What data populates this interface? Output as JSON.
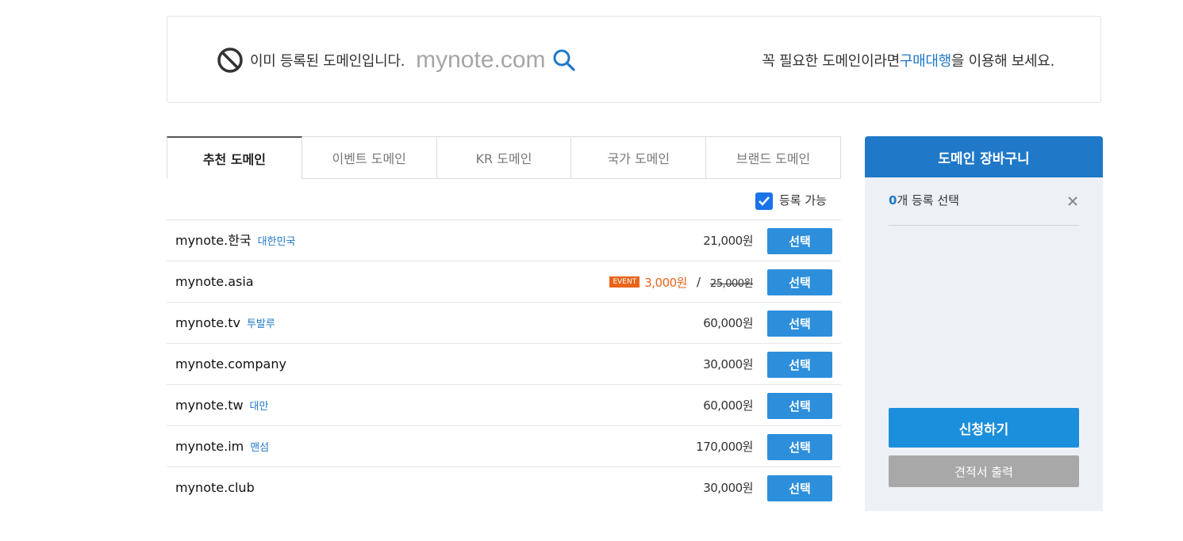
{
  "result": {
    "message": "이미 등록된 도메인입니다.",
    "query": "mynote.com",
    "hint_pre": "꼭 필요한 도메인이라면 ",
    "hint_link": "구매대행",
    "hint_post": "을 이용해 보세요.",
    "status_icon": "ban-icon",
    "search_icon": "search-icon"
  },
  "tabs": [
    {
      "label": "추천 도메인",
      "active": true
    },
    {
      "label": "이벤트 도메인",
      "active": false
    },
    {
      "label": "KR 도메인",
      "active": false
    },
    {
      "label": "국가 도메인",
      "active": false
    },
    {
      "label": "브랜드 도메인",
      "active": false
    }
  ],
  "filter": {
    "label": "등록 가능",
    "checked": true
  },
  "domains": [
    {
      "name": "mynote.한국",
      "country": "대한민국",
      "price": "21,000원",
      "button": "선택"
    },
    {
      "name": "mynote.asia",
      "country": "",
      "badge": "EVENT",
      "event_price": "3,000원",
      "separator": "/",
      "old_price": "25,000원",
      "button": "선택"
    },
    {
      "name": "mynote.tv",
      "country": "투발루",
      "price": "60,000원",
      "button": "선택"
    },
    {
      "name": "mynote.company",
      "country": "",
      "price": "30,000원",
      "button": "선택"
    },
    {
      "name": "mynote.tw",
      "country": "대만",
      "price": "60,000원",
      "button": "선택"
    },
    {
      "name": "mynote.im",
      "country": "맨섬",
      "price": "170,000원",
      "button": "선택"
    },
    {
      "name": "mynote.club",
      "country": "",
      "price": "30,000원",
      "button": "선택"
    }
  ],
  "cart": {
    "title": "도메인 장바구니",
    "count": "0",
    "count_suffix": "개 등록 선택",
    "apply_label": "신청하기",
    "quote_label": "견적서 출력"
  },
  "colors": {
    "accent": "#1f78c8",
    "button": "#2d8fdc",
    "event": "#e8651a",
    "cart_bg": "#edf1f6"
  }
}
